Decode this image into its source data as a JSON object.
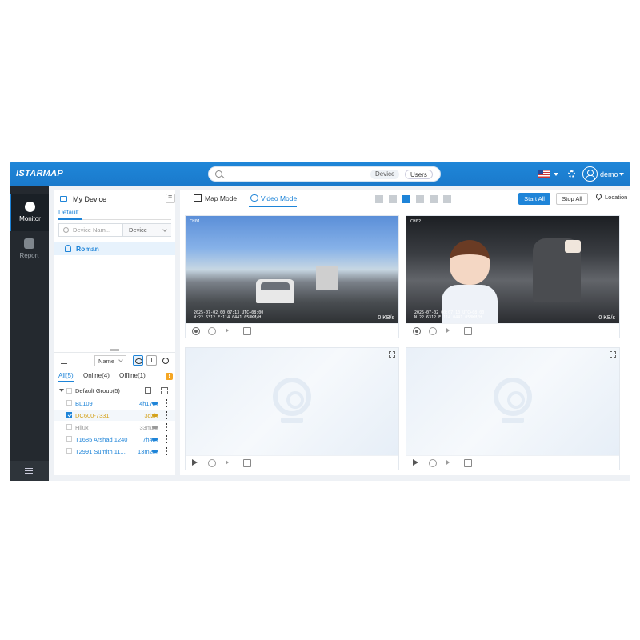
{
  "header": {
    "logo": "ISTARMAP",
    "search": {
      "placeholder": "",
      "segments": [
        "Device",
        "Users"
      ]
    },
    "user": "demo"
  },
  "nav": {
    "items": [
      {
        "label": "Monitor",
        "active": true
      },
      {
        "label": "Report",
        "active": false
      }
    ]
  },
  "device_panel": {
    "title": "My Device",
    "tab": "Default",
    "filter": {
      "placeholder": "Device Nam...",
      "type": "Device"
    },
    "tree": {
      "name": "Roman"
    },
    "sort": "Name",
    "text_toggle": "T",
    "status_tabs": {
      "all": "All(5)",
      "online": "Online(4)",
      "offline": "Offline(1)"
    },
    "warning": "!",
    "group": "Default Group(5)",
    "devices": [
      {
        "name": "BL109",
        "time": "4h17m",
        "color": "#1e84d8",
        "checked": false
      },
      {
        "name": "DC600-7331",
        "time": "3d2h",
        "color": "#d4a21c",
        "checked": true
      },
      {
        "name": "Hilux",
        "time": "33m2s",
        "color": "#999999",
        "checked": false
      },
      {
        "name": "T1685 Arshad 1240",
        "time": "7h4m",
        "color": "#1e84d8",
        "checked": false
      },
      {
        "name": "T2991 Sumith 11...",
        "time": "13m2...",
        "color": "#1e84d8",
        "checked": false
      }
    ]
  },
  "main": {
    "tabs": {
      "map": "Map Mode",
      "video": "Video Mode"
    },
    "buttons": {
      "start_all": "Start All",
      "stop_all": "Stop All",
      "location": "Location"
    },
    "videos": [
      {
        "channel": "CH01",
        "osd_line1": "2025-07-02 00:07:13 UTC+08:00",
        "osd_line2": "N:22.6312 E:114.0441 058KM/H",
        "rate": "0 KB/s"
      },
      {
        "channel": "CH02",
        "osd_line1": "2025-07-02 00:07:13 UTC+08:00",
        "osd_line2": "N:22.6312 E:114.0441 058KM/H",
        "rate": "0 KB/s"
      }
    ]
  },
  "colors": {
    "accent": "#1e84d8",
    "sidenav": "#24292f",
    "online": "#1e84d8",
    "idle": "#d4a21c",
    "offline": "#999999"
  }
}
